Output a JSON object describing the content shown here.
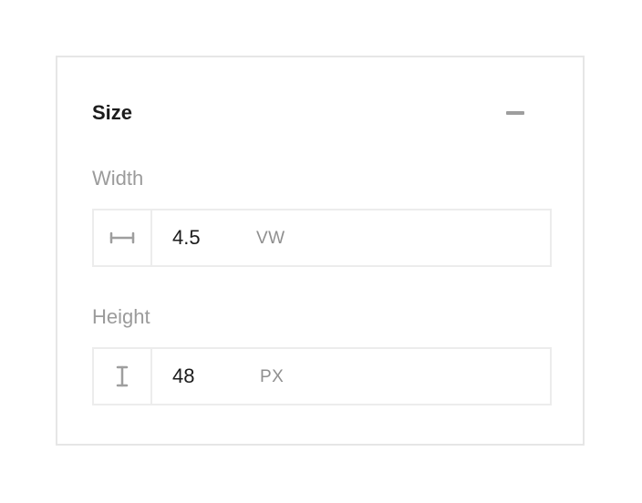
{
  "panel": {
    "title": "Size",
    "collapse_icon": "minus-icon"
  },
  "width": {
    "label": "Width",
    "icon": "width-icon",
    "value": "4.5",
    "unit": "VW"
  },
  "height": {
    "label": "Height",
    "icon": "height-icon",
    "value": "48",
    "unit": "PX"
  },
  "colors": {
    "title_text": "#1c1c1c",
    "label_text": "#9b9b9b",
    "border": "#ececec",
    "icon": "#9e9e9e"
  }
}
